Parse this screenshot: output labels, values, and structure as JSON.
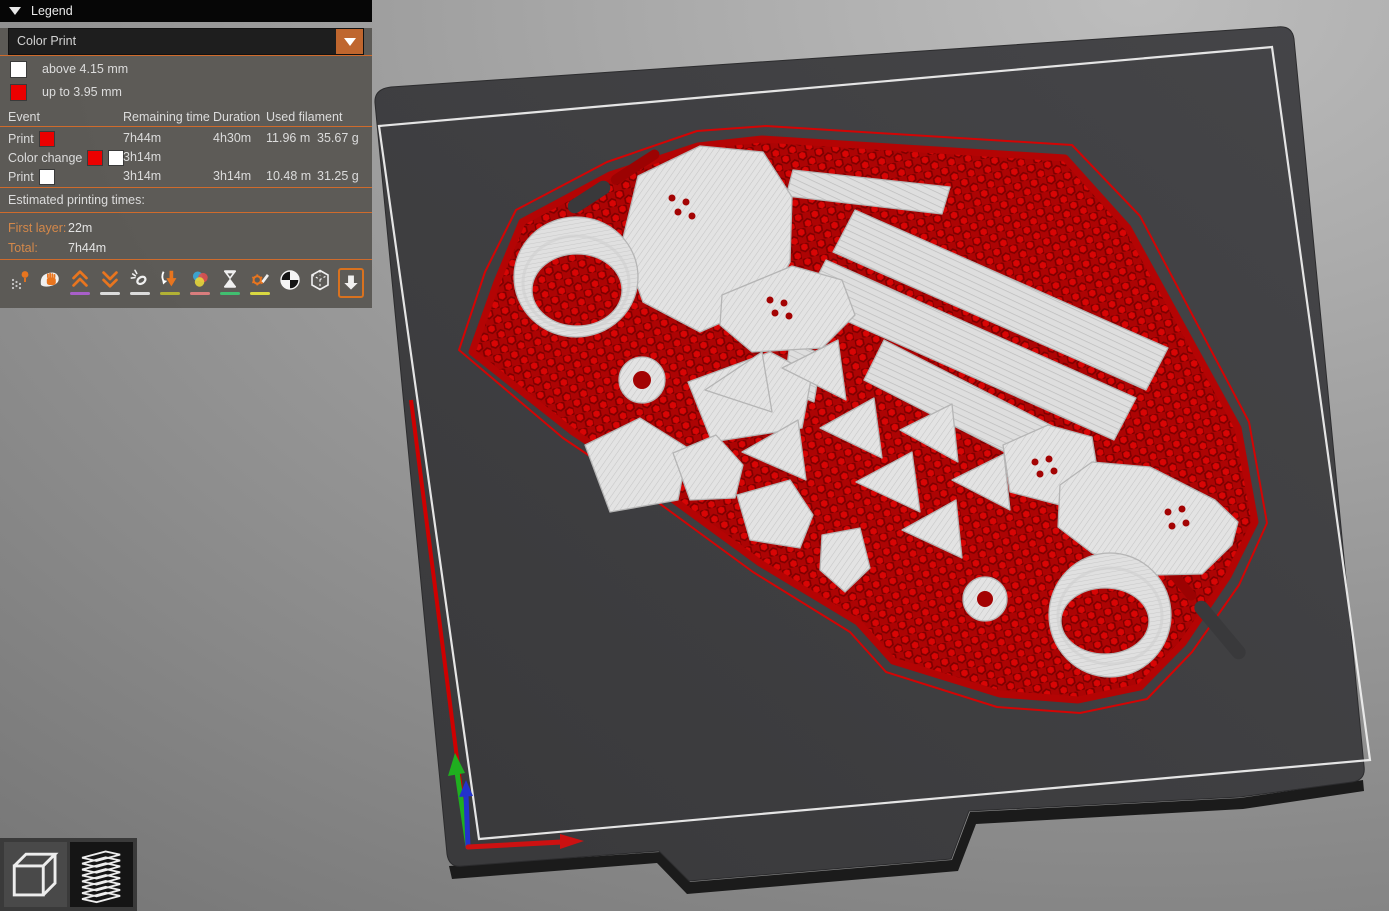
{
  "legend": {
    "title": "Legend",
    "view_select": {
      "value": "Color Print"
    },
    "height_ranges": [
      {
        "color": "#ffffff",
        "label": "above 4.15 mm"
      },
      {
        "color": "#ec0000",
        "label": "up to 3.95 mm"
      }
    ],
    "table": {
      "col_event": "Event",
      "col_remaining": "Remaining time",
      "col_duration": "Duration",
      "col_used": "Used filament",
      "rows": [
        {
          "event": "Print",
          "swatches": [
            "#ec0000"
          ],
          "remaining": "7h44m",
          "duration": "4h30m",
          "used_m": "11.96 m",
          "used_g": "35.67 g"
        },
        {
          "event": "Color change",
          "swatches": [
            "#ec0000",
            "#ffffff"
          ],
          "remaining": "3h14m",
          "duration": "",
          "used_m": "",
          "used_g": ""
        },
        {
          "event": "Print",
          "swatches": [
            "#ffffff"
          ],
          "remaining": "3h14m",
          "duration": "3h14m",
          "used_m": "10.48 m",
          "used_g": "31.25 g"
        }
      ]
    },
    "estimated_title": "Estimated printing times:",
    "first_layer_label": "First layer:",
    "first_layer_value": "22m",
    "total_label": "Total:",
    "total_value": "7h44m",
    "accent_color": "#cf6b2c",
    "toolbar_icons": [
      {
        "name": "travels"
      },
      {
        "name": "wipe"
      },
      {
        "name": "retractions",
        "underline": "#a85fc9"
      },
      {
        "name": "deretractions",
        "underline": "#41a8c9"
      },
      {
        "name": "seams",
        "underline": "#dcdcdc"
      },
      {
        "name": "tool-changes",
        "underline": "#b1b135"
      },
      {
        "name": "color-changes",
        "underline": "#d97d7d"
      },
      {
        "name": "pause-prints",
        "underline": "#41bf70"
      },
      {
        "name": "custom-gcodes",
        "underline": "#d9d941"
      },
      {
        "name": "center-of-gravity"
      },
      {
        "name": "shells"
      },
      {
        "name": "collapse-legend",
        "active": true
      }
    ]
  },
  "viewport": {
    "bed_color": "#3c3c3e",
    "print_area_border_color": "#eeeeee",
    "filament_colors": {
      "below_3_95mm": "#d60404",
      "above_4_15mm": "#e3e3e3"
    },
    "axes": [
      {
        "name": "x",
        "color": "#cc1111"
      },
      {
        "name": "y",
        "color": "#1faf1f"
      },
      {
        "name": "z",
        "color": "#2233cc"
      }
    ]
  },
  "view_toolbar": {
    "buttons": [
      {
        "name": "3d-editor-view",
        "active": false
      },
      {
        "name": "preview-view",
        "active": true
      }
    ]
  }
}
